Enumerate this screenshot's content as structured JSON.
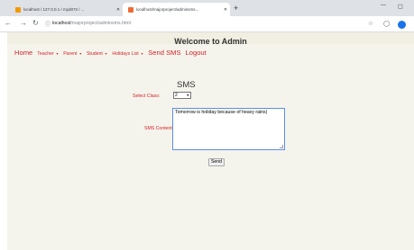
{
  "browser": {
    "tabs": [
      {
        "title": "localhost / 127.0.0.1 / myd072 / ..."
      },
      {
        "title": "localhost/majorproject/adminsms..."
      }
    ],
    "url_host": "localhost",
    "url_path": "/majorproject/adminsms.html"
  },
  "page": {
    "title": "Welcome to Admin",
    "menu": [
      {
        "label": "Home",
        "has_caret": false,
        "size": "big"
      },
      {
        "label": "Teacher",
        "has_caret": true,
        "size": "small"
      },
      {
        "label": "Parent",
        "has_caret": true,
        "size": "small"
      },
      {
        "label": "Student",
        "has_caret": true,
        "size": "small"
      },
      {
        "label": "Holidays List",
        "has_caret": true,
        "size": "small"
      },
      {
        "label": "Send SMS",
        "has_caret": false,
        "size": "big"
      },
      {
        "label": "Logout",
        "has_caret": false,
        "size": "big"
      }
    ],
    "accent_color": "#d2232a"
  },
  "form": {
    "heading": "SMS",
    "class_label": "Select Class:",
    "class_value": "2",
    "content_label": "SMS Content:",
    "content_value": "Tomorrow is holiday because of heavy rains|",
    "send_label": "Send"
  }
}
